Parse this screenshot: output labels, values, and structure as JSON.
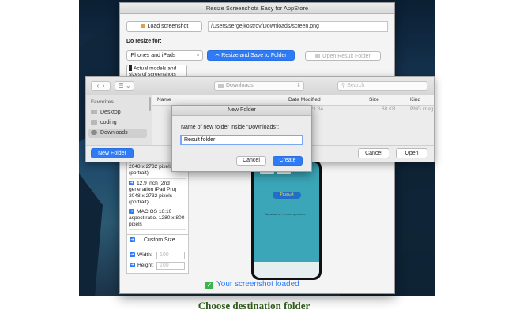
{
  "caption": "Choose destination folder",
  "main_window": {
    "title": "Resize Screenshots Easy for AppStore",
    "load_button": "Load screenshot",
    "path_value": "/Users/sergejkostrov/Downloads/screen.png",
    "do_resize_label": "Do resize for:",
    "device_select": "iPhones and iPads",
    "resize_button": "Resize and Save to Folder",
    "open_result_button": "Open Result Folder",
    "models_button": "Actual models and sizes of screenshots",
    "list_items": [
      "generation iPad Pro) 2048 x 2732 pixels (portrait)",
      "12.9 inch (2nd generation iPad Pro) 2048 x 2732 pixels (portrait)",
      "MAC OS 16:10 aspect ratio. 1280 x 800 pixels"
    ],
    "custom_size_label": "Custom Size",
    "width_label": "Width:",
    "width_placeholder": "100",
    "height_label": "Height:",
    "height_placeholder": "100",
    "loaded_message": "Your screenshot loaded",
    "phone_button_text": "Разсый",
    "phone_caption": "Вы можете... текст третьего"
  },
  "file_dialog": {
    "location": "Downloads",
    "search_placeholder": "Search",
    "favorites_header": "Favorites",
    "favorites": [
      "Desktop",
      "coding",
      "Downloads"
    ],
    "columns": [
      "Name",
      "Date Modified",
      "Size",
      "Kind"
    ],
    "row": {
      "date": "21:34",
      "size": "68 KB",
      "kind": "PNG imag"
    },
    "new_folder_button": "New Folder",
    "cancel_button": "Cancel",
    "open_button": "Open"
  },
  "new_folder_sheet": {
    "title": "New Folder",
    "prompt": "Name of new folder inside “Downloads”:",
    "input_value": "Result folder",
    "cancel_button": "Cancel",
    "create_button": "Create"
  },
  "colors": {
    "accent": "#2f7bf6",
    "success": "#3bb54a",
    "caption": "#2e5a1a"
  }
}
